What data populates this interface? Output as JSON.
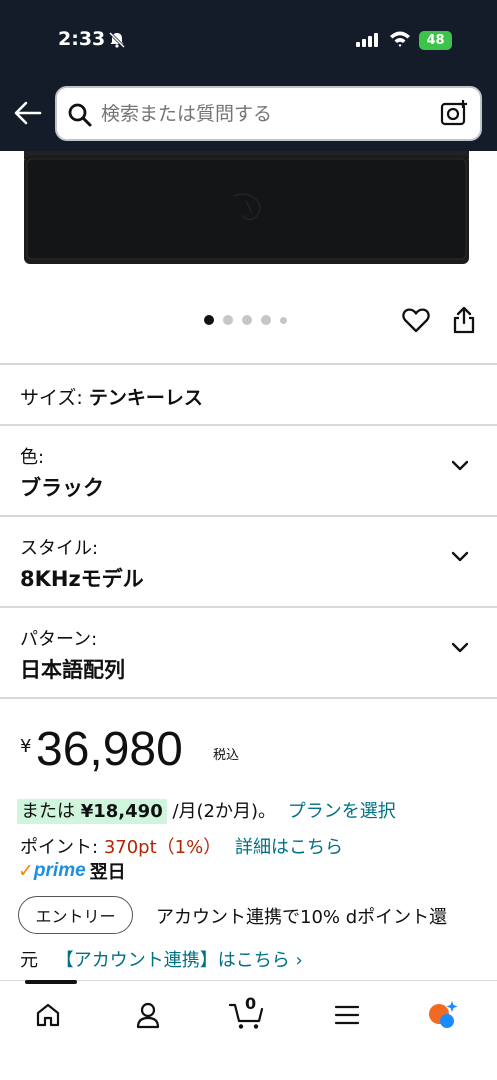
{
  "status": {
    "time": "2:33",
    "battery": "48"
  },
  "search": {
    "placeholder": "検索または質問する"
  },
  "gallery": {
    "dots": 5,
    "active_index": 0
  },
  "size": {
    "label": "サイズ:",
    "value": "テンキーレス"
  },
  "variations": [
    {
      "label": "色:",
      "value": "ブラック"
    },
    {
      "label": "スタイル:",
      "value": "8KHzモデル"
    },
    {
      "label": "パターン:",
      "value": "日本語配列"
    }
  ],
  "price": {
    "currency": "¥",
    "amount": "36,980",
    "tax_label": "税込",
    "installment_prefix": "または",
    "installment_amount": "¥18,490",
    "installment_suffix": "/月(2か月)。",
    "installment_link": "プランを選択"
  },
  "points": {
    "label": "ポイント:",
    "value": "370pt（1%）",
    "link": "詳細はこちら"
  },
  "prime": {
    "check": "✓",
    "word": "prime",
    "delivery": "翌日"
  },
  "entry": {
    "button_label": "エントリー",
    "text_line1": "アカウント連携で10% dポイント還",
    "text_line2": "元",
    "link": "【アカウント連携】はこちら ›"
  },
  "nav": {
    "items": [
      "home-icon",
      "account-icon",
      "cart-icon",
      "menu-icon",
      "rufus-icon"
    ],
    "cart_count": "0"
  }
}
